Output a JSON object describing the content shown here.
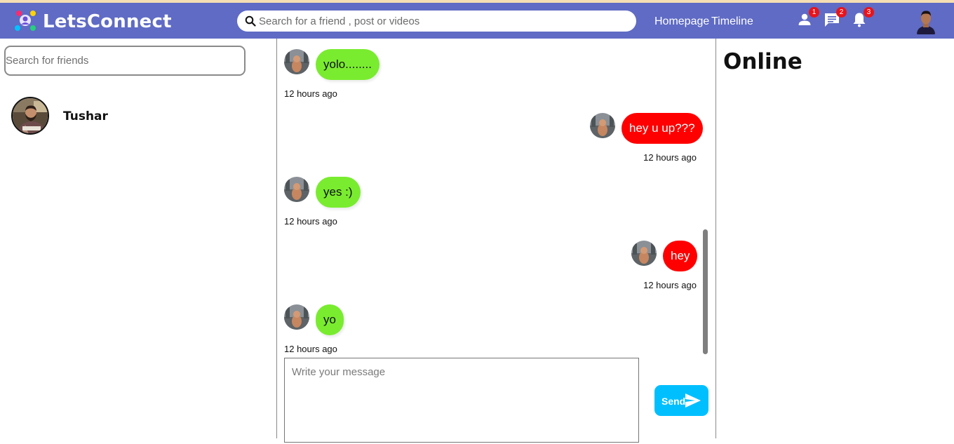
{
  "app": {
    "brand": "LetsConnect",
    "search_placeholder": "Search for a friend , post or videos",
    "nav": {
      "homepage": "Homepage",
      "timeline": "Timeline"
    },
    "badges": {
      "friends": "1",
      "messages": "2",
      "notifications": "3"
    },
    "icons": [
      "logo-icon",
      "search-icon",
      "person-icon",
      "chat-icon",
      "bell-icon",
      "send-icon"
    ]
  },
  "sidebar": {
    "search_placeholder": "Search for friends",
    "friends": [
      {
        "name": "Tushar"
      }
    ]
  },
  "chat": {
    "messages": [
      {
        "text": "yolo........",
        "time": "12 hours ago",
        "own": false
      },
      {
        "text": "hey u up???",
        "time": "12 hours ago",
        "own": true
      },
      {
        "text": "yes :)",
        "time": "12 hours ago",
        "own": false
      },
      {
        "text": "hey",
        "time": "12 hours ago",
        "own": true
      },
      {
        "text": "yo",
        "time": "12 hours ago",
        "own": false
      }
    ],
    "input_placeholder": "Write your message",
    "send_label": "Send"
  },
  "online": {
    "title": "Online"
  },
  "colors": {
    "topbar": "#5f6bc4",
    "received_bubble": "#79ec2f",
    "sent_bubble": "#ff0000",
    "send_button": "#00bfff",
    "badge": "#e8141b"
  }
}
